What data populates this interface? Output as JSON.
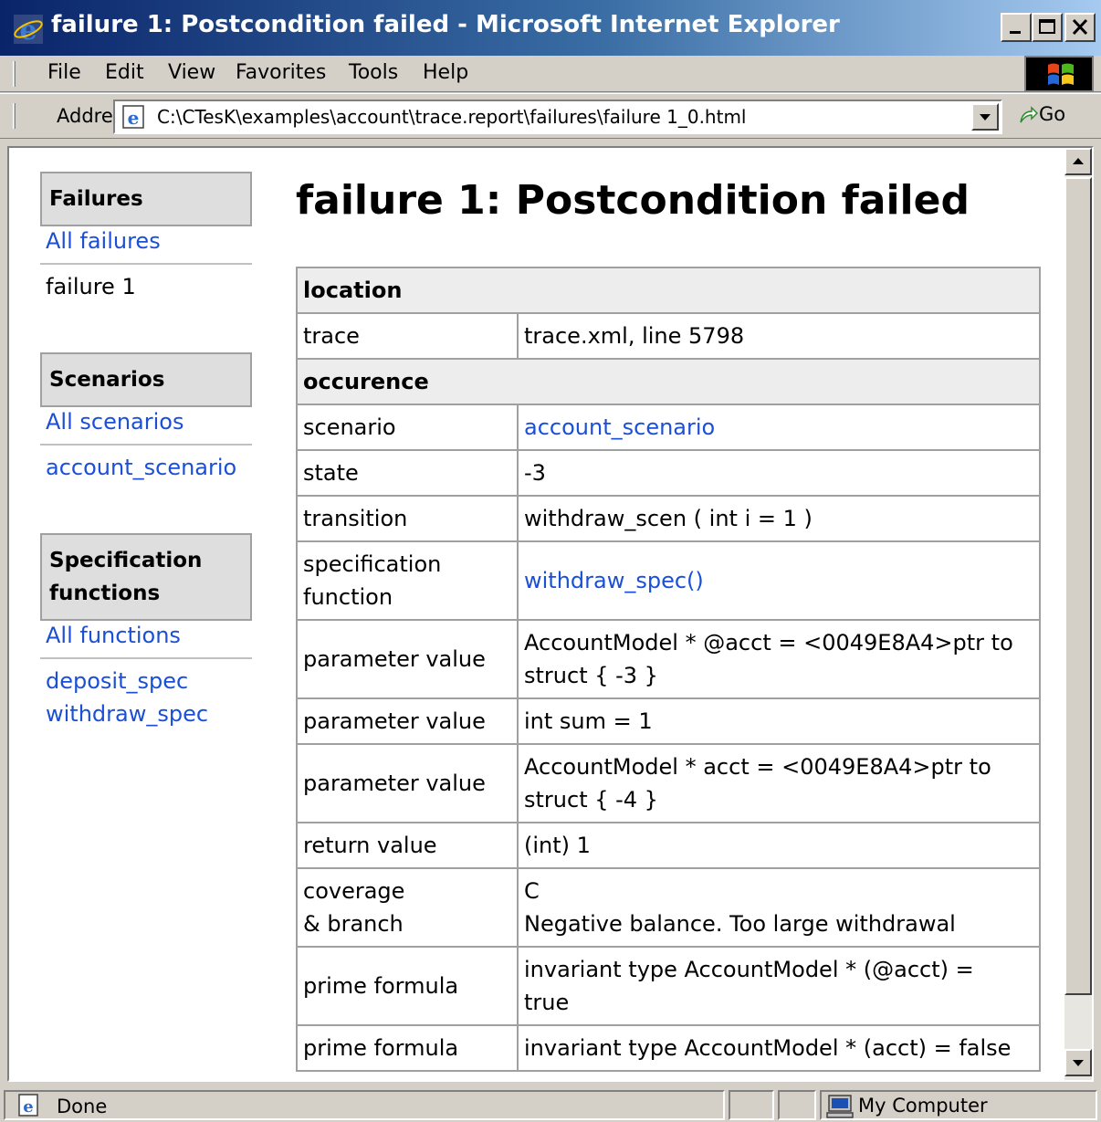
{
  "window": {
    "title": "failure 1: Postcondition failed - Microsoft Internet Explorer",
    "icon": "ie-icon",
    "buttons": [
      "minimize-icon",
      "maximize-icon",
      "close-icon"
    ]
  },
  "menu": {
    "file": "File",
    "edit": "Edit",
    "view": "View",
    "favorites": "Favorites",
    "tools": "Tools",
    "help": "Help"
  },
  "address": {
    "label": "Address",
    "value": "C:\\CTesK\\examples\\account\\trace.report\\failures\\failure 1_0.html",
    "go": "Go"
  },
  "sidebar": {
    "failures": {
      "heading": "Failures",
      "all_link": "All failures",
      "items": [
        "failure 1"
      ]
    },
    "scenarios": {
      "heading": "Scenarios",
      "all_link": "All scenarios",
      "items": [
        "account_scenario"
      ]
    },
    "functions": {
      "heading_line1": "Specification",
      "heading_line2": "functions",
      "all_link": "All functions",
      "items": [
        "deposit_spec",
        "withdraw_spec"
      ]
    }
  },
  "page": {
    "heading": "failure 1: Postcondition failed"
  },
  "table": {
    "location_header": "location",
    "trace_label": "trace",
    "trace_value": "trace.xml, line 5798",
    "occurence_header": "occurence",
    "scenario_label": "scenario",
    "scenario_value": "account_scenario",
    "state_label": "state",
    "state_value": "-3",
    "transition_label": "transition",
    "transition_value": "withdraw_scen ( int i = 1 )",
    "spec_label_line1": "specification",
    "spec_label_line2": "function",
    "spec_value": "withdraw_spec()",
    "param1_label": "parameter value",
    "param1_line1": "AccountModel * @acct = <0049E8A4>ptr to",
    "param1_line2": "struct { -3 }",
    "param2_label": "parameter value",
    "param2_value": "int sum = 1",
    "param3_label": "parameter value",
    "param3_line1": "AccountModel * acct = <0049E8A4>ptr to",
    "param3_line2": "struct { -4 }",
    "return_label": "return value",
    "return_value": "(int) 1",
    "coverage_label_line1": "coverage",
    "coverage_label_line2": "& branch",
    "coverage_line1": "C",
    "coverage_line2": "Negative balance. Too large withdrawal",
    "prime1_label": "prime formula",
    "prime1_line1": "invariant type AccountModel * (@acct) =",
    "prime1_line2": "true",
    "prime2_label": "prime formula",
    "prime2_value": "invariant type AccountModel * (acct) = false"
  },
  "status": {
    "text": "Done",
    "zone": "My Computer"
  }
}
